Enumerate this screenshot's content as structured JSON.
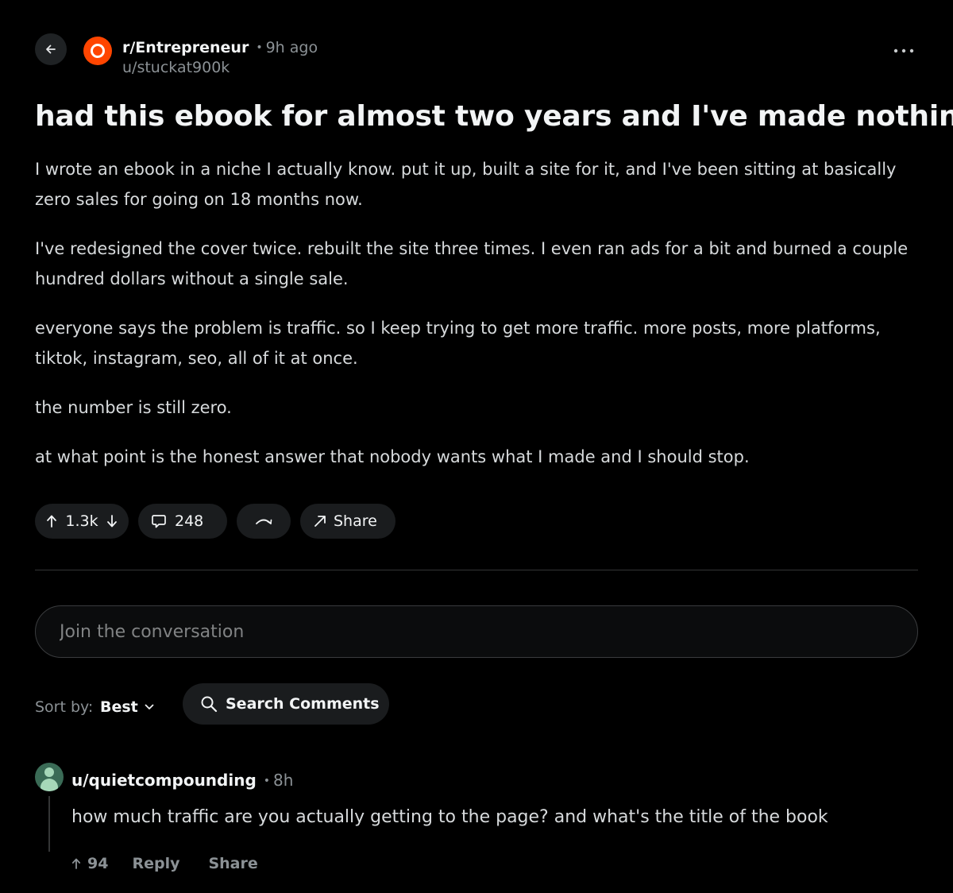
{
  "post": {
    "subreddit": "r/Entrepreneur",
    "time": "9h ago",
    "author": "u/stuckat900k",
    "title": "had this ebook for almost two years and I've made nothing",
    "paragraphs": [
      "I wrote an ebook in a niche I actually know. put it up, built a site for it, and I've been sitting at basically zero sales for going on 18 months now.",
      "I've redesigned the cover twice. rebuilt the site three times. I even ran ads for a bit and burned a couple hundred dollars without a single sale.",
      "everyone says the problem is traffic. so I keep trying to get more traffic. more posts, more platforms, tiktok, instagram, seo, all of it at once.",
      "the number is still zero.",
      "at what point is the honest answer that nobody wants what I made and I should stop."
    ],
    "votes": "1.3k",
    "comments": "248",
    "share_label": "Share"
  },
  "composer": {
    "placeholder": "Join the conversation"
  },
  "sort": {
    "label": "Sort by:",
    "value": "Best"
  },
  "search": {
    "label": "Search Comments"
  },
  "comment": {
    "author": "u/quietcompounding",
    "time": "8h",
    "text": "how much traffic are you actually getting to the page? and what's the title of the book",
    "votes": "94",
    "reply_label": "Reply",
    "share_label": "Share"
  },
  "colors": {
    "background": "#000000",
    "subreddit_avatar": "#ff4500",
    "pill": "#1a1c1e",
    "muted_text": "#8b9195",
    "comment_avatar": "#3a6b56"
  },
  "icons": {
    "back": "arrow-left-icon",
    "more": "more-horizontal-icon",
    "upvote": "arrow-up-icon",
    "downvote": "arrow-down-icon",
    "comment": "comment-bubble-icon",
    "award": "award-icon",
    "share": "share-arrow-icon",
    "sort": "chevron-down-icon",
    "search": "search-icon"
  }
}
